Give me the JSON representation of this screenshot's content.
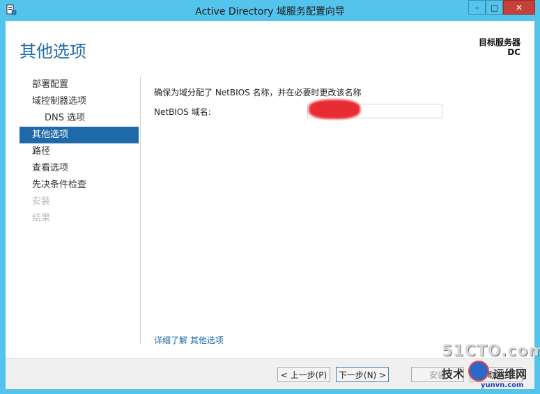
{
  "window": {
    "title": "Active Directory 域服务配置向导",
    "icon": "server-wizard-icon",
    "controls": {
      "minimize": "–",
      "maximize": "□",
      "close": "✕"
    }
  },
  "header": {
    "page_title": "其他选项",
    "target_label": "目标服务器",
    "target_value": "DC"
  },
  "nav": {
    "items": [
      {
        "label": "部署配置",
        "state": "normal"
      },
      {
        "label": "域控制器选项",
        "state": "normal"
      },
      {
        "label": "DNS 选项",
        "state": "sub"
      },
      {
        "label": "其他选项",
        "state": "active"
      },
      {
        "label": "路径",
        "state": "normal"
      },
      {
        "label": "查看选项",
        "state": "normal"
      },
      {
        "label": "先决条件检查",
        "state": "normal"
      },
      {
        "label": "安装",
        "state": "disabled"
      },
      {
        "label": "结果",
        "state": "disabled"
      }
    ]
  },
  "content": {
    "description": "确保为域分配了 NetBIOS 名称，并在必要时更改该名称",
    "netbios_label": "NetBIOS 域名:",
    "netbios_value": "",
    "more_link": "详细了解 其他选项"
  },
  "footer": {
    "prev": "< 上一步(P)",
    "next": "下一步(N) >",
    "install": "安装",
    "cancel": "取消"
  },
  "watermark": {
    "line1": "51CTO.com",
    "line2a": "技术",
    "line2b": "运维网",
    "site": "yunvn.com"
  },
  "colors": {
    "accent": "#1e6aa8",
    "frame": "#55c4ec",
    "close": "#c6403a",
    "redaction": "#e8202a"
  }
}
